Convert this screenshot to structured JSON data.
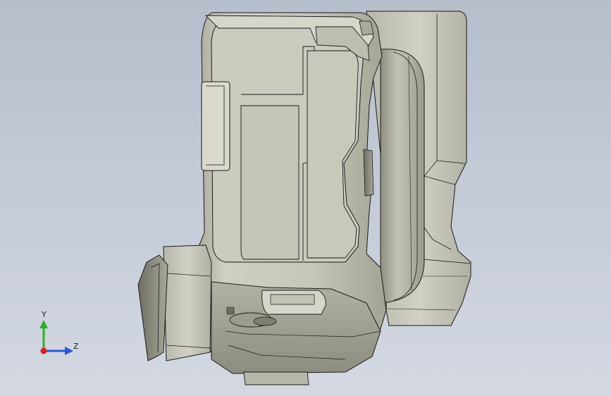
{
  "viewport": {
    "background_top": "#b6bdcb",
    "background_bottom": "#d3d8e1",
    "model_shade": "#c9c9bd",
    "edge_color": "#1a1a1a"
  },
  "triad": {
    "y_label": "Y",
    "z_label": "Z",
    "y_color": "#2eae2e",
    "z_color": "#2a55d6",
    "origin_color": "#d42020"
  }
}
